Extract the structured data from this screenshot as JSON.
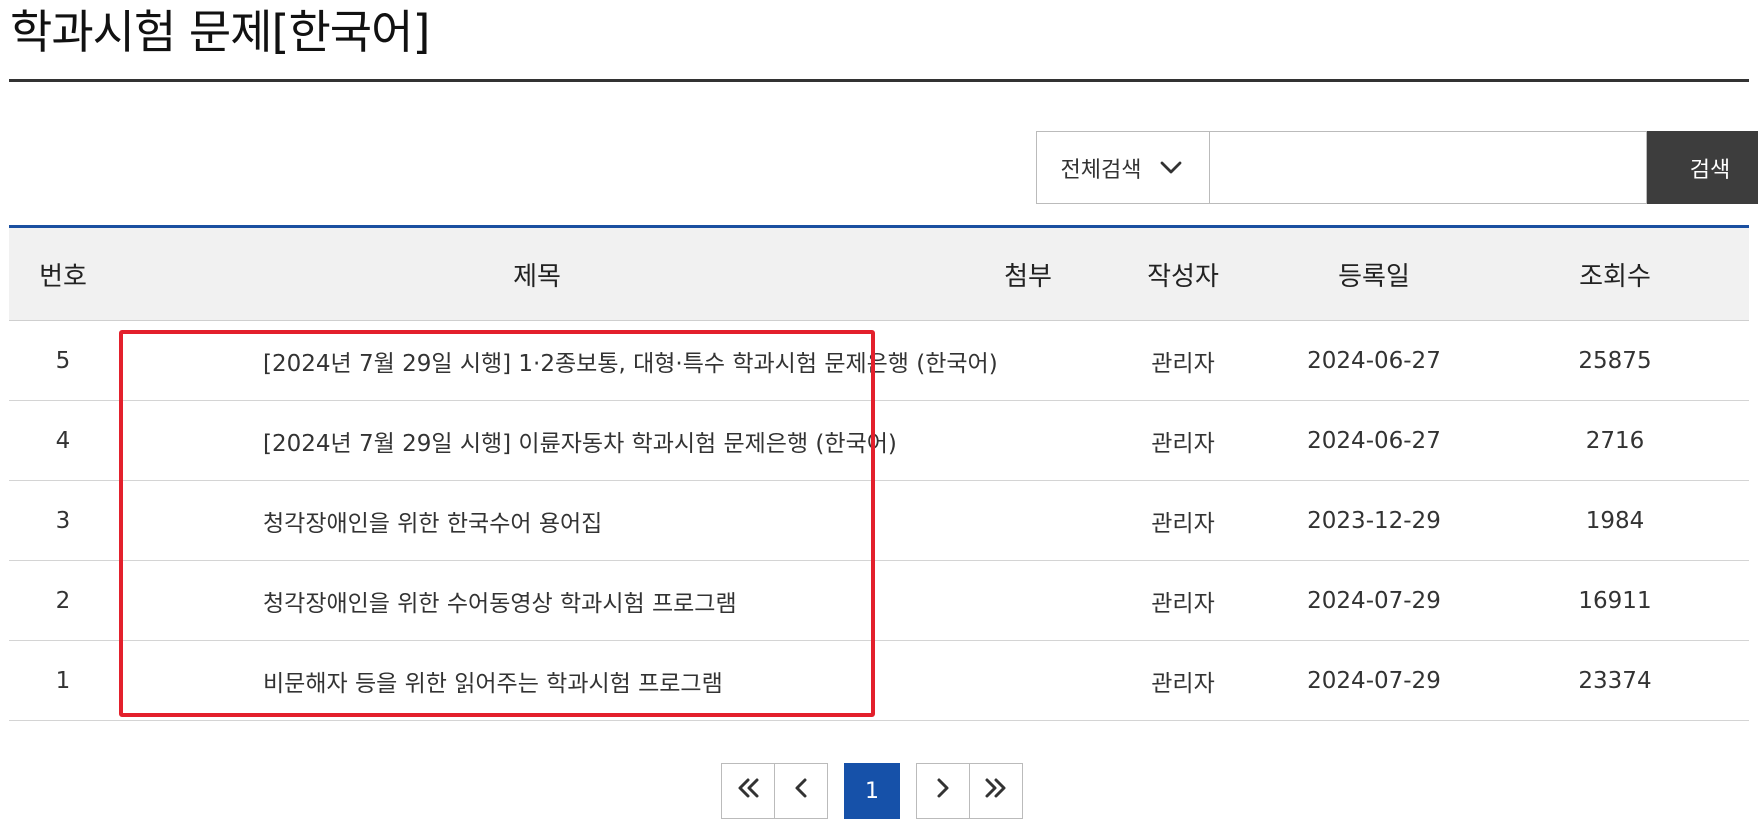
{
  "page": {
    "title": "학과시험 문제[한국어]"
  },
  "search": {
    "scope_label": "전체검색",
    "input_value": "",
    "button_label": "검색"
  },
  "table": {
    "headers": {
      "no": "번호",
      "title": "제목",
      "attach": "첨부",
      "author": "작성자",
      "date": "등록일",
      "views": "조회수"
    },
    "rows": [
      {
        "no": "5",
        "title": "[2024년 7월 29일 시행] 1·2종보통, 대형·특수 학과시험 문제은행 (한국어)",
        "attach": "",
        "author": "관리자",
        "date": "2024-06-27",
        "views": "25875"
      },
      {
        "no": "4",
        "title": "[2024년 7월 29일 시행] 이륜자동차 학과시험 문제은행 (한국어)",
        "attach": "",
        "author": "관리자",
        "date": "2024-06-27",
        "views": "2716"
      },
      {
        "no": "3",
        "title": "청각장애인을 위한 한국수어 용어집",
        "attach": "",
        "author": "관리자",
        "date": "2023-12-29",
        "views": "1984"
      },
      {
        "no": "2",
        "title": "청각장애인을 위한 수어동영상 학과시험 프로그램",
        "attach": "",
        "author": "관리자",
        "date": "2024-07-29",
        "views": "16911"
      },
      {
        "no": "1",
        "title": "비문해자 등을 위한 읽어주는 학과시험 프로그램",
        "attach": "",
        "author": "관리자",
        "date": "2024-07-29",
        "views": "23374"
      }
    ]
  },
  "pagination": {
    "current_page": "1"
  },
  "colors": {
    "accent": "#1651a9",
    "highlight": "#e3202c",
    "search_button": "#3d3d3d"
  },
  "icons": {
    "dropdown": "chevron-down-icon",
    "first": "double-chevron-left-icon",
    "prev": "chevron-left-icon",
    "next": "chevron-right-icon",
    "last": "double-chevron-right-icon"
  }
}
